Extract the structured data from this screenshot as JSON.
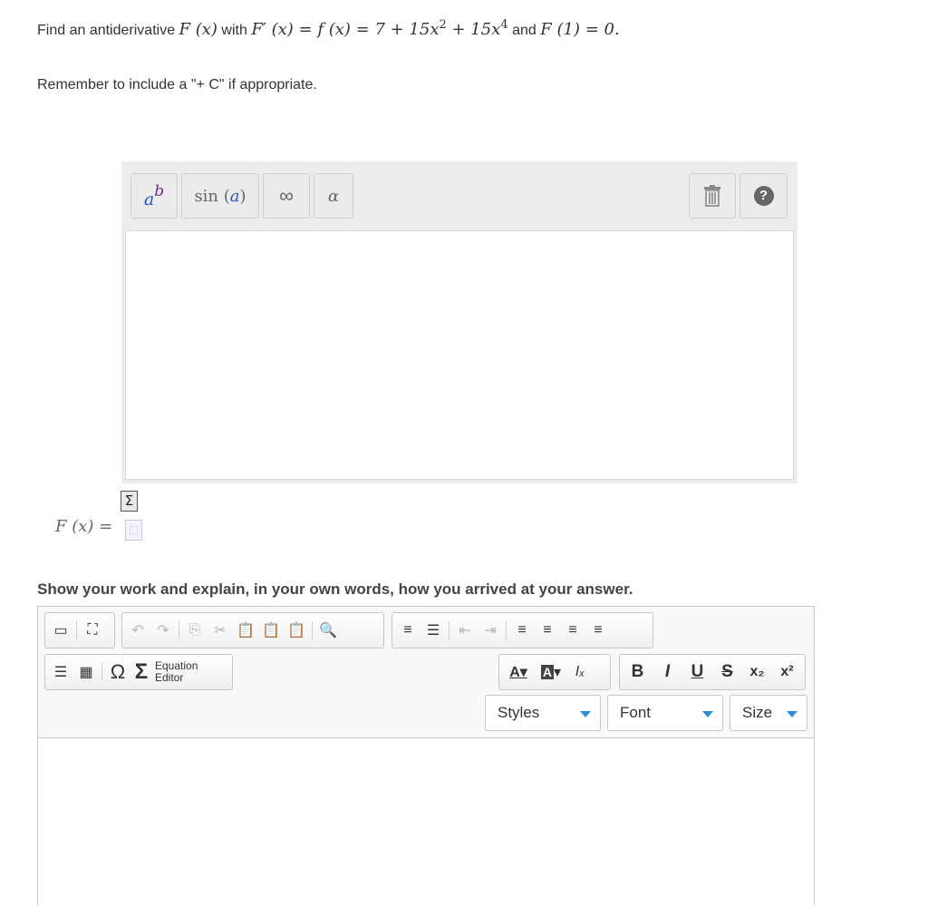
{
  "question": {
    "prefix": "Find an antiderivative",
    "with": "with",
    "and": "and",
    "F_of_x": "F (x)",
    "derivative_expr": "F′ (x) = f (x) = 7 + 15x",
    "exp2": "2",
    "mid_term": " + 15x",
    "exp4": "4",
    "condition": "F (1) = 0."
  },
  "reminder": "Remember to include a \"+ C\" if appropriate.",
  "eq_editor": {
    "power_btn_base": "a",
    "power_btn_exp": "b",
    "sin_btn_fn": "sin",
    "sin_btn_arg": "a",
    "infinity_btn": "∞",
    "alpha_btn": "α",
    "help_btn": "?"
  },
  "answer_label": "F (x) =",
  "work_prompt": "Show your work and explain, in your own words, how you arrived at your answer.",
  "rte": {
    "equation_editor_line1": "Equation",
    "equation_editor_line2": "Editor",
    "bold": "B",
    "italic": "I",
    "underline": "U",
    "strike": "S",
    "subscript": "x₂",
    "superscript": "x²",
    "omega": "Ω",
    "sigma": "Σ",
    "styles_label": "Styles",
    "font_label": "Font",
    "size_label": "Size"
  },
  "colors": {
    "accent": "#2c8fd6",
    "toolbar_bg": "#ececec"
  }
}
